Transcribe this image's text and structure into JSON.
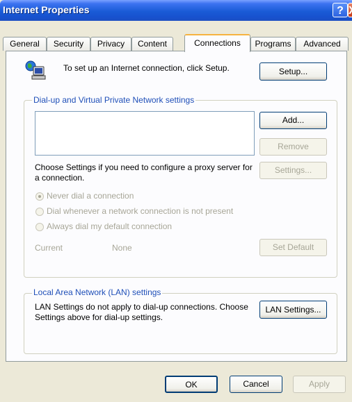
{
  "window": {
    "title": "Internet Properties"
  },
  "titlebar": {
    "help_label": "?",
    "close_label": "X"
  },
  "tabs": [
    {
      "label": "General"
    },
    {
      "label": "Security"
    },
    {
      "label": "Privacy"
    },
    {
      "label": "Content"
    },
    {
      "label": "Connections"
    },
    {
      "label": "Programs"
    },
    {
      "label": "Advanced"
    }
  ],
  "setup": {
    "text": "To set up an Internet connection, click Setup.",
    "button_label": "Setup..."
  },
  "dialup": {
    "legend": "Dial-up and Virtual Private Network settings",
    "add_label": "Add...",
    "remove_label": "Remove",
    "settings_text": "Choose Settings if you need to configure a proxy server for a connection.",
    "settings_label": "Settings...",
    "radios": [
      {
        "label": "Never dial a connection",
        "selected": true
      },
      {
        "label": "Dial whenever a network connection is not present",
        "selected": false
      },
      {
        "label": "Always dial my default connection",
        "selected": false
      }
    ],
    "current_label": "Current",
    "current_value": "None",
    "set_default_label": "Set Default"
  },
  "lan": {
    "legend": "Local Area Network (LAN) settings",
    "text": "LAN Settings do not apply to dial-up connections. Choose Settings above for dial-up settings.",
    "button_label": "LAN Settings..."
  },
  "footer": {
    "ok_label": "OK",
    "cancel_label": "Cancel",
    "apply_label": "Apply"
  }
}
